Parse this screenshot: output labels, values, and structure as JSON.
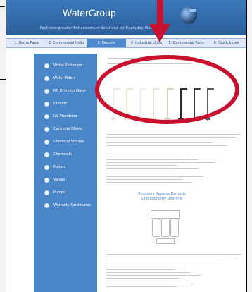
{
  "header": {
    "title": "WaterGroup",
    "tagline": "Fashioning water Enhancement Solutions for Everyday Water"
  },
  "nav": {
    "tabs": [
      {
        "label": "1. Home Page"
      },
      {
        "label": "2. Commercial Units"
      },
      {
        "label": "3. Faucets",
        "active": true
      },
      {
        "label": "4. Industrial Units"
      },
      {
        "label": "5. Commercial Parts"
      },
      {
        "label": "6. Stock Index"
      }
    ]
  },
  "sidebar": {
    "items": [
      {
        "label": "Water Softeners"
      },
      {
        "label": "Water Filters"
      },
      {
        "label": "RO Drinking Water"
      },
      {
        "label": "Faucets"
      },
      {
        "label": "UV Sterilizers"
      },
      {
        "label": "Cartridge Filters"
      },
      {
        "label": "Chemical Storage"
      },
      {
        "label": "Chemicals"
      },
      {
        "label": "Meters"
      },
      {
        "label": "Valves"
      },
      {
        "label": "Pumps"
      },
      {
        "label": "Warranty Certificates"
      }
    ]
  },
  "content": {
    "promo_title": "Economy Reverse Osmosis Unit Economy Unit Info"
  },
  "colors": {
    "header_blue": "#2b5f9b",
    "sidebar_blue": "#4a86c8",
    "nav_active": "#4f89cc",
    "annotation_red": "#c8102e"
  }
}
